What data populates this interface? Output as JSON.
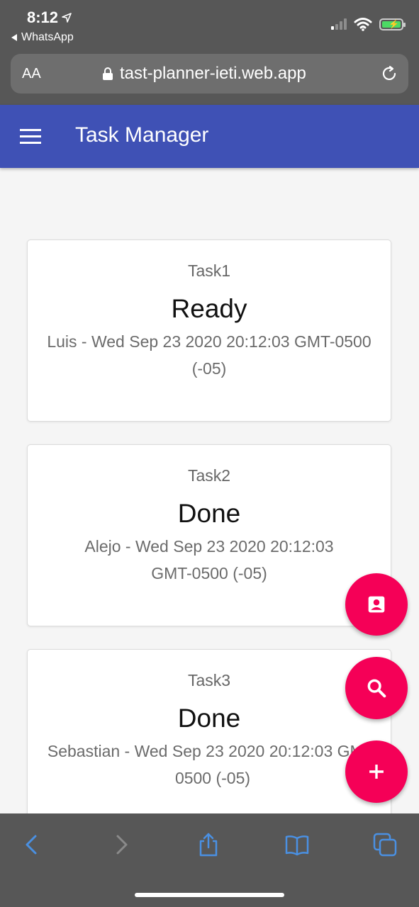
{
  "status_bar": {
    "time": "8:12",
    "back_app": "WhatsApp"
  },
  "browser": {
    "text_size_label": "AA",
    "url": "tast-planner-ieti.web.app"
  },
  "app_bar": {
    "title": "Task Manager"
  },
  "tasks": [
    {
      "name": "Task1",
      "status": "Ready",
      "meta": "Luis - Wed Sep 23 2020 20:12:03 GMT-0500 (-05)"
    },
    {
      "name": "Task2",
      "status": "Done",
      "meta": "Alejo - Wed Sep 23 2020 20:12:03 GMT-0500 (-05)"
    },
    {
      "name": "Task3",
      "status": "Done",
      "meta": "Sebastian - Wed Sep 23 2020 20:12:03 GMT-0500 (-05)"
    }
  ],
  "fabs": [
    {
      "icon": "contact-icon"
    },
    {
      "icon": "search-icon"
    },
    {
      "icon": "add-icon"
    }
  ],
  "colors": {
    "app_bar": "#3f51b5",
    "fab": "#f50057",
    "browser_chrome": "#575757",
    "toolbar_icon": "#4a90e2"
  }
}
